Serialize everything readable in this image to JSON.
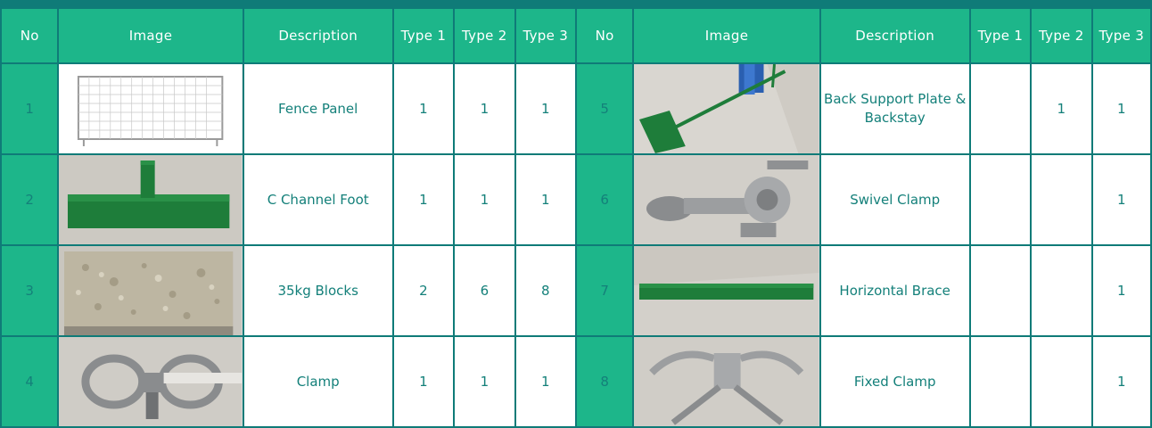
{
  "headers": [
    "No",
    "Image",
    "Description",
    "Type 1",
    "Type 2",
    "Type 3",
    "No",
    "Image",
    "Description",
    "Type 1",
    "Type 2",
    "Type 3"
  ],
  "rows": [
    {
      "left": {
        "no": "1",
        "image": "fence-panel-photo",
        "description": "Fence Panel",
        "type1": "1",
        "type2": "1",
        "type3": "1"
      },
      "right": {
        "no": "5",
        "image": "back-support-photo",
        "description": "Back Support Plate & Backstay",
        "type1": "",
        "type2": "1",
        "type3": "1"
      }
    },
    {
      "left": {
        "no": "2",
        "image": "c-channel-foot-photo",
        "description": "C Channel Foot",
        "type1": "1",
        "type2": "1",
        "type3": "1"
      },
      "right": {
        "no": "6",
        "image": "swivel-clamp-photo",
        "description": "Swivel Clamp",
        "type1": "",
        "type2": "",
        "type3": "1"
      }
    },
    {
      "left": {
        "no": "3",
        "image": "concrete-block-photo",
        "description": "35kg Blocks",
        "type1": "2",
        "type2": "6",
        "type3": "8"
      },
      "right": {
        "no": "7",
        "image": "horizontal-brace-photo",
        "description": "Horizontal Brace",
        "type1": "",
        "type2": "",
        "type3": "1"
      }
    },
    {
      "left": {
        "no": "4",
        "image": "clamp-photo",
        "description": "Clamp",
        "type1": "1",
        "type2": "1",
        "type3": "1"
      },
      "right": {
        "no": "8",
        "image": "fixed-clamp-photo",
        "description": "Fixed Clamp",
        "type1": "",
        "type2": "",
        "type3": "1"
      }
    }
  ],
  "colors": {
    "header": "#1db68a",
    "border": "#0f7b78",
    "text": "#14807a",
    "photo_green": "#1e7d3a"
  }
}
